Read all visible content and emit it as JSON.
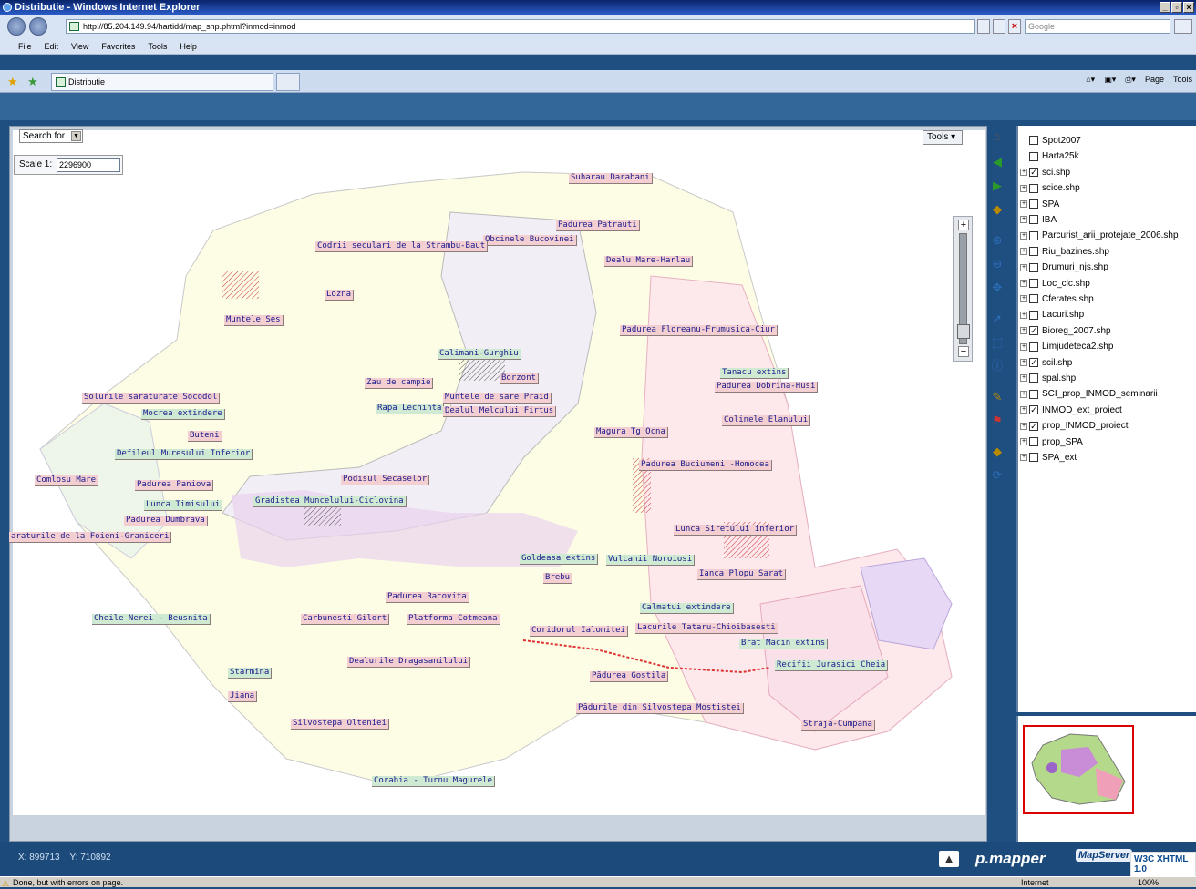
{
  "window": {
    "title": "Distributie - Windows Internet Explorer"
  },
  "browser": {
    "url": "http://85.204.149.94/hartidd/map_shp.phtml?inmod=inmod",
    "search_placeholder": "Google",
    "menu": [
      "File",
      "Edit",
      "View",
      "Favorites",
      "Tools",
      "Help"
    ],
    "tab_title": "Distributie",
    "tools_right": [
      "Page",
      "Tools"
    ]
  },
  "map": {
    "search_label": "Search for",
    "tools_label": "Tools",
    "scale_label": "Scale 1:",
    "scale_value": "2296900",
    "labels": [
      {
        "text": "Suharau Darabani",
        "style": "pink"
      },
      {
        "text": "Padurea Patrauti",
        "style": "pink"
      },
      {
        "text": "Obcinele Bucovinei",
        "style": "pink"
      },
      {
        "text": "Codrii seculari de la Strambu-Baut",
        "style": "pink"
      },
      {
        "text": "Dealu Mare-Harlau",
        "style": "pink"
      },
      {
        "text": "Lozna",
        "style": "pink"
      },
      {
        "text": "Muntele Ses",
        "style": "pink"
      },
      {
        "text": "Padurea Floreanu-Frumusica-Ciur",
        "style": "pink"
      },
      {
        "text": "Calimani-Gurghiu",
        "style": "green"
      },
      {
        "text": "Borzont",
        "style": "pink"
      },
      {
        "text": "Zau de campie",
        "style": "pink"
      },
      {
        "text": "Tanacu extins",
        "style": "green"
      },
      {
        "text": "Padurea Dobrina-Husi",
        "style": "pink"
      },
      {
        "text": "Solurile saraturate Socodol",
        "style": "pink"
      },
      {
        "text": "Muntele de sare Praid",
        "style": "pink"
      },
      {
        "text": "Rapa Lechinta",
        "style": "green"
      },
      {
        "text": "Dealul Melcului Firtus",
        "style": "pink"
      },
      {
        "text": "Mocrea extindere",
        "style": "green"
      },
      {
        "text": "Colinele Elanului",
        "style": "pink"
      },
      {
        "text": "Magura Tg Ocna",
        "style": "pink"
      },
      {
        "text": "Buteni",
        "style": "pink"
      },
      {
        "text": "Defileul Muresului Inferior",
        "style": "green"
      },
      {
        "text": "Padurea Buciumeni -Homocea",
        "style": "pink"
      },
      {
        "text": "Comlosu Mare",
        "style": "pink"
      },
      {
        "text": "Padurea Paniova",
        "style": "pink"
      },
      {
        "text": "Podisul Secaselor",
        "style": "pink"
      },
      {
        "text": "Gradistea Muncelului-Ciclovina",
        "style": "green"
      },
      {
        "text": "Lunca Timisului",
        "style": "green"
      },
      {
        "text": "Padurea Dumbrava",
        "style": "pink"
      },
      {
        "text": "Lunca Siretului inferior",
        "style": "pink"
      },
      {
        "text": "araturile de la Foieni-Graniceri",
        "style": "pink"
      },
      {
        "text": "Goldeasa extins",
        "style": "green"
      },
      {
        "text": "Vulcanii Noroiosi",
        "style": "green"
      },
      {
        "text": "Brebu",
        "style": "pink"
      },
      {
        "text": "Ianca Plopu Sarat",
        "style": "pink"
      },
      {
        "text": "Padurea Racovita",
        "style": "pink"
      },
      {
        "text": "Calmatui extindere",
        "style": "green"
      },
      {
        "text": "Cheile Nerei - Beusnita",
        "style": "green"
      },
      {
        "text": "Carbunesti Gilort",
        "style": "pink"
      },
      {
        "text": "Platforma Cotmeana",
        "style": "pink"
      },
      {
        "text": "Coridorul Ialomitei",
        "style": "pink"
      },
      {
        "text": "Lacurile Tataru-Chioibasesti",
        "style": "pink"
      },
      {
        "text": "Brat Macin extins",
        "style": "green"
      },
      {
        "text": "Dealurile Dragasanilului",
        "style": "pink"
      },
      {
        "text": "Recifii Jurasici  Cheia",
        "style": "green"
      },
      {
        "text": "Starmina",
        "style": "green"
      },
      {
        "text": "Pădurea Gostila",
        "style": "pink"
      },
      {
        "text": "Jiana",
        "style": "pink"
      },
      {
        "text": "Pădurile din Silvostepa Mostistei",
        "style": "pink"
      },
      {
        "text": "Silvostepa Olteniei",
        "style": "pink"
      },
      {
        "text": "Straja-Cumpana",
        "style": "pink"
      },
      {
        "text": "Corabia - Turnu Magurele",
        "style": "green"
      }
    ]
  },
  "layers": [
    {
      "name": "Spot2007",
      "checked": false,
      "expand": false
    },
    {
      "name": "Harta25k",
      "checked": false,
      "expand": false
    },
    {
      "name": "sci.shp",
      "checked": true,
      "expand": true
    },
    {
      "name": "scice.shp",
      "checked": false,
      "expand": true
    },
    {
      "name": "SPA",
      "checked": false,
      "expand": true
    },
    {
      "name": "IBA",
      "checked": false,
      "expand": true
    },
    {
      "name": "Parcurist_arii_protejate_2006.shp",
      "checked": false,
      "expand": true
    },
    {
      "name": "Riu_bazines.shp",
      "checked": false,
      "expand": true
    },
    {
      "name": "Drumuri_njs.shp",
      "checked": false,
      "expand": true
    },
    {
      "name": "Loc_clc.shp",
      "checked": false,
      "expand": true
    },
    {
      "name": "Cferates.shp",
      "checked": false,
      "expand": true
    },
    {
      "name": "Lacuri.shp",
      "checked": false,
      "expand": true
    },
    {
      "name": "Bioreg_2007.shp",
      "checked": true,
      "expand": true
    },
    {
      "name": "Limjudeteca2.shp",
      "checked": false,
      "expand": true
    },
    {
      "name": "scil.shp",
      "checked": true,
      "expand": true
    },
    {
      "name": "spal.shp",
      "checked": false,
      "expand": true
    },
    {
      "name": "SCI_prop_INMOD_seminarii",
      "checked": false,
      "expand": true
    },
    {
      "name": "INMOD_ext_proiect",
      "checked": true,
      "expand": true
    },
    {
      "name": "prop_INMOD_proiect",
      "checked": true,
      "expand": true
    },
    {
      "name": "prop_SPA",
      "checked": false,
      "expand": true
    },
    {
      "name": "SPA_ext",
      "checked": false,
      "expand": true
    }
  ],
  "footer": {
    "x_label": "X:",
    "x_value": "899713",
    "y_label": "Y:",
    "y_value": "710892",
    "brand": "p.mapper",
    "mapserver": "MapServer",
    "w3c": "W3C XHTML 1.0"
  },
  "ie_status": {
    "text": "Done, but with errors on page.",
    "zone": "Internet",
    "zoom": "100%"
  }
}
